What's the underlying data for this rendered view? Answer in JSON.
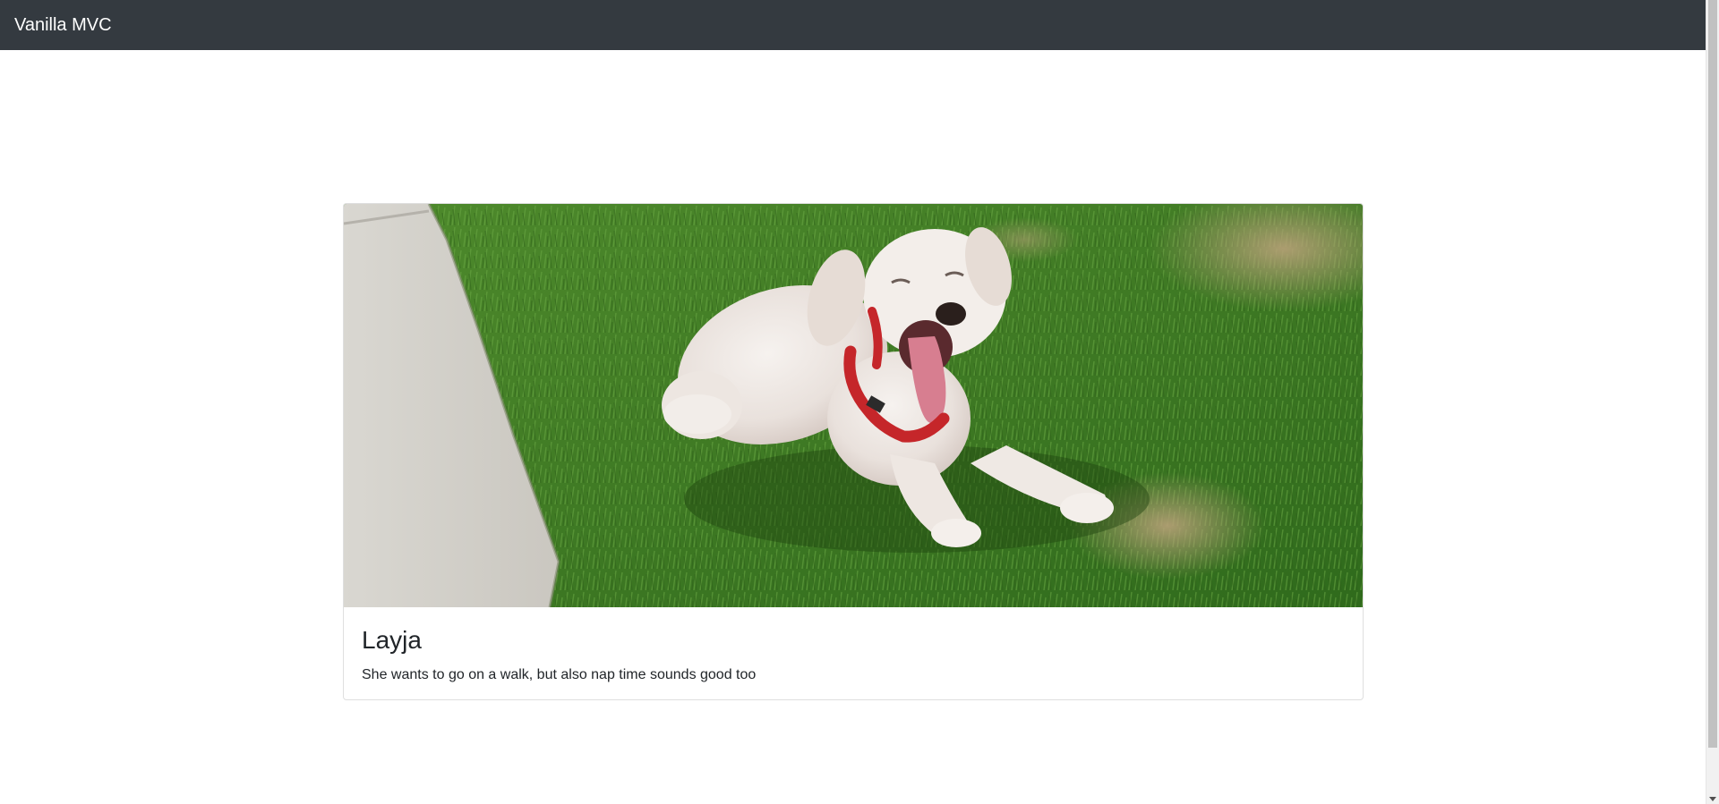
{
  "navbar": {
    "brand": "Vanilla MVC",
    "background": "#343a40"
  },
  "card": {
    "image_alt": "white dog yawning on grass",
    "title": "Layja",
    "text": "She wants to go on a walk, but also nap time sounds good too"
  }
}
